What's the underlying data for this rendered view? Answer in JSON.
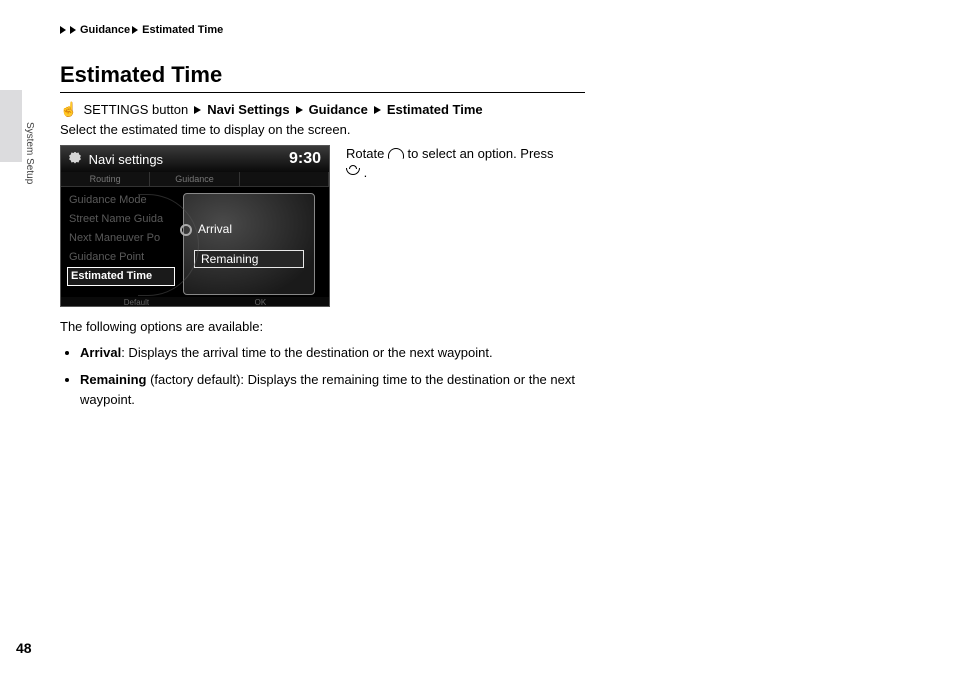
{
  "breadcrumb": {
    "item1": "Guidance",
    "item2": "Estimated Time"
  },
  "section_tab": "System Setup",
  "title": "Estimated Time",
  "path": {
    "start": "SETTINGS button",
    "s1": "Navi Settings",
    "s2": "Guidance",
    "s3": "Estimated Time"
  },
  "intro": "Select the estimated time to display on the screen.",
  "instruction": {
    "p1": "Rotate ",
    "p2": " to select an option. Press ",
    "p3": "."
  },
  "screen": {
    "header_title": "Navi settings",
    "clock": "9:30",
    "tabs": {
      "t1": "Routing",
      "t2": "Guidance",
      "t3": ""
    },
    "menu": {
      "m1": "Guidance Mode",
      "m2": "Street Name Guida",
      "m3": "Next Maneuver Po",
      "m4": "Guidance Point",
      "m5": "Estimated Time"
    },
    "popup": {
      "opt1": "Arrival",
      "opt2": "Remaining"
    },
    "footer": {
      "f1": "Default",
      "f2": "OK"
    }
  },
  "below_intro": "The following options are available:",
  "options": {
    "arrival": {
      "label": "Arrival",
      "desc": ": Displays the arrival time to the destination or the next waypoint."
    },
    "remaining": {
      "label": "Remaining",
      "note": " (factory default)",
      "desc": ": Displays the remaining time to the destination or the next waypoint."
    }
  },
  "page_number": "48"
}
